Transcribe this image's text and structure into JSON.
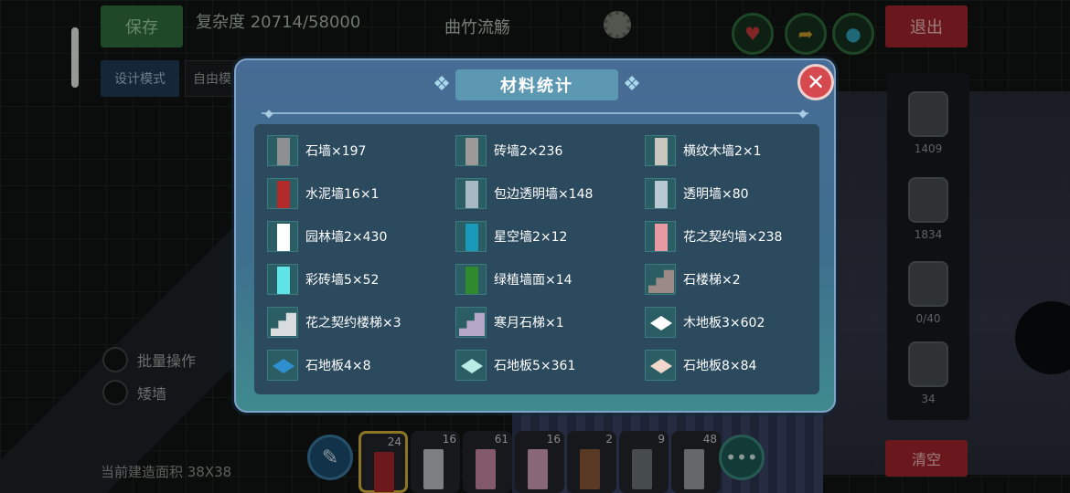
{
  "hud": {
    "save_label": "保存",
    "complexity": "复杂度 20714/58000",
    "map_name": "曲竹流觞",
    "exit_label": "退出",
    "mode_label": "设计模式",
    "free_label": "自由模",
    "batch_label": "批量操作",
    "low_wall_label": "矮墙",
    "area_label": "当前建造面积 38X38",
    "clear_label": "清空"
  },
  "side_panel": {
    "counts": [
      "1409",
      "1834",
      "0/40",
      "34"
    ]
  },
  "toolbar": {
    "slots": [
      {
        "count": "24",
        "color": "#a8262a"
      },
      {
        "count": "16",
        "color": "#bfc3c6"
      },
      {
        "count": "61",
        "color": "#c98aa6"
      },
      {
        "count": "16",
        "color": "#d1a0b8"
      },
      {
        "count": "2",
        "color": "#8a5a3a"
      },
      {
        "count": "9",
        "color": "#6d7478"
      },
      {
        "count": "48",
        "color": "#9ba0a3"
      }
    ]
  },
  "modal": {
    "title": "材料统计",
    "items": [
      {
        "label": "石墙×197",
        "icon": "stone-wall-icon",
        "kind": "wall",
        "color": "#8e8f90"
      },
      {
        "label": "砖墙2×236",
        "icon": "brick-wall-icon",
        "kind": "wall",
        "color": "#9c9a96"
      },
      {
        "label": "横纹木墙2×1",
        "icon": "striped-wood-wall-icon",
        "kind": "wall",
        "color": "#c9c6c0"
      },
      {
        "label": "水泥墙16×1",
        "icon": "cement-wall-icon",
        "kind": "wall",
        "color": "#b32a2a"
      },
      {
        "label": "包边透明墙×148",
        "icon": "edged-glass-wall-icon",
        "kind": "wall",
        "color": "#a9b9c4"
      },
      {
        "label": "透明墙×80",
        "icon": "glass-wall-icon",
        "kind": "wall",
        "color": "#b9c9d3"
      },
      {
        "label": "园林墙2×430",
        "icon": "garden-wall-icon",
        "kind": "wall",
        "color": "#ffffff"
      },
      {
        "label": "星空墙2×12",
        "icon": "starry-wall-icon",
        "kind": "wall",
        "color": "#1a9ab8"
      },
      {
        "label": "花之契约墙×238",
        "icon": "flower-pact-wall-icon",
        "kind": "wall",
        "color": "#e89aa4"
      },
      {
        "label": "彩砖墙5×52",
        "icon": "color-brick-wall-icon",
        "kind": "wall",
        "color": "#5fe3e6"
      },
      {
        "label": "绿植墙面×14",
        "icon": "green-plant-wall-icon",
        "kind": "wall",
        "color": "#2f8a2d"
      },
      {
        "label": "石楼梯×2",
        "icon": "stone-stairs-icon",
        "kind": "stairs",
        "color": "#9c8a86"
      },
      {
        "label": "花之契约楼梯×3",
        "icon": "flower-pact-stairs-icon",
        "kind": "stairs",
        "color": "#d9dcde"
      },
      {
        "label": "寒月石梯×1",
        "icon": "cold-moon-stairs-icon",
        "kind": "stairs",
        "color": "#b4a8c6"
      },
      {
        "label": "木地板3×602",
        "icon": "wood-floor-icon",
        "kind": "floor",
        "color": "#ffffff"
      },
      {
        "label": "石地板4×8",
        "icon": "stone-floor-4-icon",
        "kind": "floor",
        "color": "#2f8fd0"
      },
      {
        "label": "石地板5×361",
        "icon": "stone-floor-5-icon",
        "kind": "floor",
        "color": "#b8ece6"
      },
      {
        "label": "石地板8×84",
        "icon": "stone-floor-8-icon",
        "kind": "floor",
        "color": "#f1d8cd"
      }
    ]
  }
}
